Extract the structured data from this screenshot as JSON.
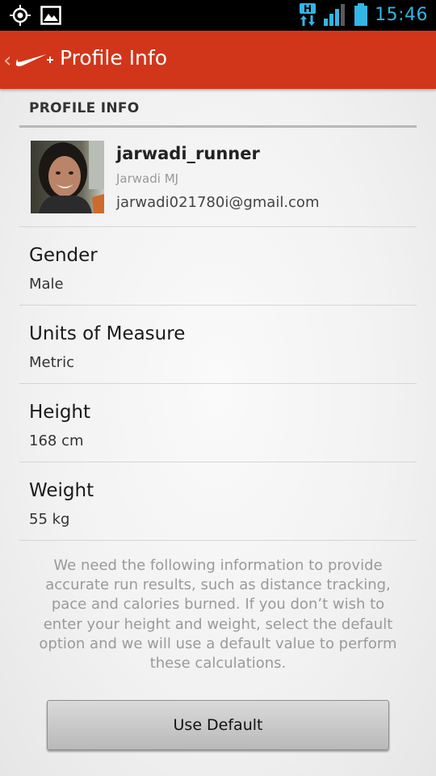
{
  "status_bar": {
    "time": "15:46",
    "network_type": "H",
    "icons": [
      "gps-icon",
      "gallery-icon",
      "network-h-icon",
      "signal-icon",
      "battery-icon"
    ]
  },
  "action_bar": {
    "title": "Profile Info",
    "logo": "nike-plus-logo",
    "back_icon": "back-chevron-icon",
    "color": "#d1361a"
  },
  "section": {
    "header": "PROFILE INFO"
  },
  "profile": {
    "username": "jarwadi_runner",
    "full_name": "Jarwadi MJ",
    "email": "jarwadi021780i@gmail.com"
  },
  "settings": [
    {
      "label": "Gender",
      "value": "Male"
    },
    {
      "label": "Units of Measure",
      "value": "Metric"
    },
    {
      "label": "Height",
      "value": "168 cm"
    },
    {
      "label": "Weight",
      "value": "55 kg"
    }
  ],
  "info_text": "We need the following information to provide accurate run results, such as distance tracking, pace and calories burned. If you don’t wish to enter your height and weight, select the default option and we will use a default value to perform these calculations.",
  "button": {
    "label": "Use Default"
  }
}
